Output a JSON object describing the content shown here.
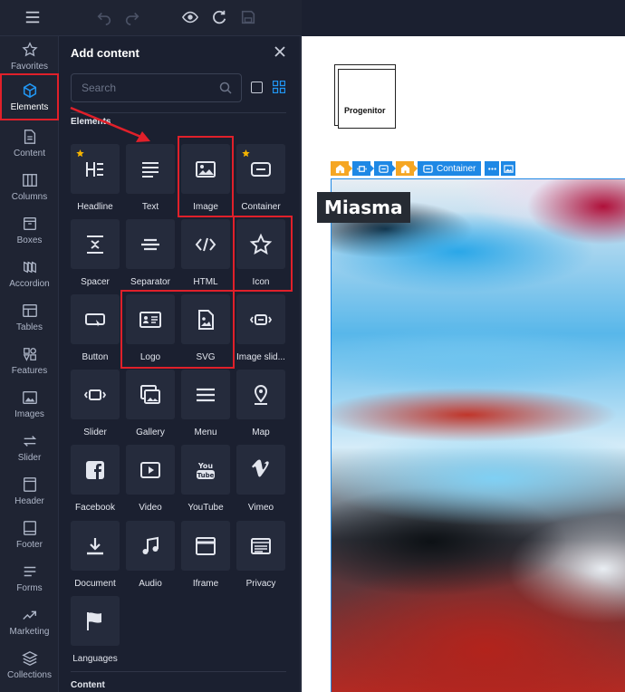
{
  "colors": {
    "accent": "#2196f3",
    "highlight": "#e0202a",
    "star": "#f5b400"
  },
  "toolbar": {
    "icons": [
      "menu-icon",
      "undo-icon",
      "redo-icon",
      "eye-icon",
      "refresh-icon",
      "save-icon"
    ]
  },
  "rail": {
    "items": [
      {
        "label": "Favorites",
        "icon": "star-icon"
      },
      {
        "label": "Elements",
        "icon": "cube-icon",
        "active": true
      },
      {
        "label": "Content",
        "icon": "document-icon"
      },
      {
        "label": "Columns",
        "icon": "columns-icon"
      },
      {
        "label": "Boxes",
        "icon": "box-icon"
      },
      {
        "label": "Accordion",
        "icon": "accordion-icon"
      },
      {
        "label": "Tables",
        "icon": "table-icon"
      },
      {
        "label": "Features",
        "icon": "features-icon"
      },
      {
        "label": "Images",
        "icon": "image-icon"
      },
      {
        "label": "Slider",
        "icon": "arrows-icon"
      },
      {
        "label": "Header",
        "icon": "header-icon"
      },
      {
        "label": "Footer",
        "icon": "footer-icon"
      },
      {
        "label": "Forms",
        "icon": "forms-icon"
      },
      {
        "label": "Marketing",
        "icon": "trend-icon"
      },
      {
        "label": "Collections",
        "icon": "layers-icon"
      }
    ]
  },
  "panel": {
    "title": "Add content",
    "search_placeholder": "Search",
    "section_elements": "Elements",
    "section_content": "Content",
    "tiles": [
      {
        "label": "Headline",
        "icon": "headline-icon",
        "starred": true
      },
      {
        "label": "Text",
        "icon": "text-icon"
      },
      {
        "label": "Image",
        "icon": "image-icon"
      },
      {
        "label": "Container",
        "icon": "container-icon",
        "starred": true
      },
      {
        "label": "Spacer",
        "icon": "spacer-icon"
      },
      {
        "label": "Separator",
        "icon": "separator-icon"
      },
      {
        "label": "HTML",
        "icon": "code-icon"
      },
      {
        "label": "Icon",
        "icon": "star-outline-icon"
      },
      {
        "label": "Button",
        "icon": "button-icon"
      },
      {
        "label": "Logo",
        "icon": "logo-icon"
      },
      {
        "label": "SVG",
        "icon": "svg-icon"
      },
      {
        "label": "Image slid...",
        "icon": "image-slider-icon"
      },
      {
        "label": "Slider",
        "icon": "slider-icon"
      },
      {
        "label": "Gallery",
        "icon": "gallery-icon"
      },
      {
        "label": "Menu",
        "icon": "menu-icon"
      },
      {
        "label": "Map",
        "icon": "map-pin-icon"
      },
      {
        "label": "Facebook",
        "icon": "facebook-icon"
      },
      {
        "label": "Video",
        "icon": "video-icon"
      },
      {
        "label": "YouTube",
        "icon": "youtube-icon"
      },
      {
        "label": "Vimeo",
        "icon": "vimeo-icon"
      },
      {
        "label": "Document",
        "icon": "download-icon"
      },
      {
        "label": "Audio",
        "icon": "music-icon"
      },
      {
        "label": "Iframe",
        "icon": "iframe-icon"
      },
      {
        "label": "Privacy",
        "icon": "privacy-icon"
      },
      {
        "label": "Languages",
        "icon": "flag-icon"
      }
    ]
  },
  "canvas": {
    "logo_text": "Progenitor",
    "breadcrumb": {
      "items": [
        {
          "icon": "section-icon",
          "color": "orange"
        },
        {
          "icon": "slider-icon",
          "color": "blue"
        },
        {
          "icon": "container-icon",
          "color": "blue"
        },
        {
          "icon": "section-icon",
          "color": "orange"
        },
        {
          "icon": "container-icon",
          "color": "blue",
          "label": "Container"
        },
        {
          "icon": "more-icon",
          "color": "blue"
        },
        {
          "icon": "image-icon",
          "color": "blue"
        }
      ]
    },
    "heading": "Miasma"
  }
}
